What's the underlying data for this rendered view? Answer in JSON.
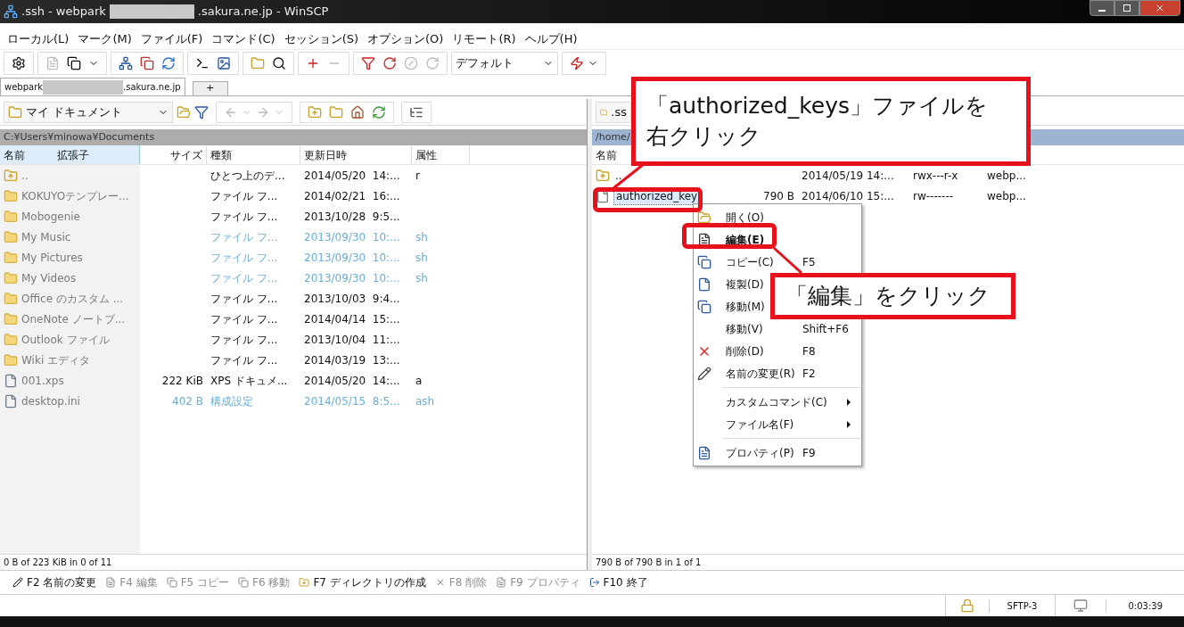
{
  "window": {
    "title_start": ".ssh - webpark",
    "title_end": ".sakura.ne.jp - WinSCP"
  },
  "menu": [
    "ローカル(L)",
    "マーク(M)",
    "ファイル(F)",
    "コマンド(C)",
    "セッション(S)",
    "オプション(O)",
    "リモート(R)",
    "ヘルプ(H)"
  ],
  "toolbar": {
    "transfer_preset": "デフォルト"
  },
  "tabs": [
    {
      "label_start": "webpark",
      "label_end": ".sakura.ne.jp",
      "selected": true
    }
  ],
  "new_tab": "+",
  "local": {
    "location": "マイ ドキュメント",
    "path": "C:¥Users¥minowa¥Documents",
    "columns": [
      "名前",
      "拡張子",
      "サイズ",
      "種類",
      "更新日時",
      "属性"
    ],
    "rows": [
      {
        "kind": "parent",
        "name": "..",
        "type": "ひとつ上のデ...",
        "date": "2014/05/20  14:...",
        "attr": "r",
        "hidden": false
      },
      {
        "kind": "folder",
        "name": "KOKUYOテンプレー...",
        "type": "ファイル フ...",
        "date": "2014/02/21  16:...",
        "hidden": false
      },
      {
        "kind": "folder",
        "name": "Mobogenie",
        "type": "ファイル フ...",
        "date": "2013/10/28  9:5...",
        "hidden": false
      },
      {
        "kind": "folder",
        "name": "My Music",
        "type": "ファイル フ...",
        "date": "2013/09/30  10:...",
        "attr": "sh",
        "hidden": true
      },
      {
        "kind": "folder",
        "name": "My Pictures",
        "type": "ファイル フ...",
        "date": "2013/09/30  10:...",
        "attr": "sh",
        "hidden": true
      },
      {
        "kind": "folder",
        "name": "My Videos",
        "type": "ファイル フ...",
        "date": "2013/09/30  10:...",
        "attr": "sh",
        "hidden": true
      },
      {
        "kind": "folder",
        "name": "Office のカスタム ...",
        "type": "ファイル フ...",
        "date": "2013/10/03  9:4...",
        "hidden": false
      },
      {
        "kind": "folder",
        "name": "OneNote ノートブ...",
        "type": "ファイル フ...",
        "date": "2014/04/14  15:...",
        "hidden": false
      },
      {
        "kind": "folder",
        "name": "Outlook ファイル",
        "type": "ファイル フ...",
        "date": "2013/10/04  11:...",
        "hidden": false
      },
      {
        "kind": "folder",
        "name": "Wiki エディタ",
        "type": "ファイル フ...",
        "date": "2014/03/19  13:...",
        "hidden": false
      },
      {
        "kind": "file",
        "name": "001.xps",
        "size": "222 KiB",
        "type": "XPS ドキュメ...",
        "date": "2014/05/20  14:...",
        "attr": "a",
        "hidden": false
      },
      {
        "kind": "file",
        "name": "desktop.ini",
        "size": "402 B",
        "type": "構成設定",
        "date": "2014/05/15  8:5...",
        "attr": "ash",
        "hidden": true
      }
    ],
    "status": "0 B of 223 KiB in 0 of 11"
  },
  "remote": {
    "location": ".ss",
    "path": "/home/",
    "columns": [
      "名前"
    ],
    "rows": [
      {
        "kind": "parent",
        "name": "..",
        "date": "2014/05/19 14:...",
        "rights": "rwx---r-x",
        "owner": "webp...",
        "selected": false
      },
      {
        "kind": "file",
        "name": "authorized_key",
        "size": "790 B",
        "date": "2014/06/10 15:...",
        "rights": "rw-------",
        "owner": "webp...",
        "selected": true
      }
    ],
    "status": "790 B of 790 B in 1 of 1"
  },
  "context_menu": [
    {
      "kind": "item",
      "label": "開く(O)",
      "bold": false
    },
    {
      "kind": "item",
      "label": "編集(E)",
      "bold": true
    },
    {
      "kind": "item",
      "label": "コピー(C)",
      "shortcut": "F5",
      "bold": false
    },
    {
      "kind": "item",
      "label": "複製(D)",
      "bold": false
    },
    {
      "kind": "item",
      "label": "移動(M)",
      "bold": false
    },
    {
      "kind": "item",
      "label": "移動(V)",
      "shortcut": "Shift+F6",
      "bold": false
    },
    {
      "kind": "item",
      "label": "削除(D)",
      "shortcut": "F8",
      "bold": false
    },
    {
      "kind": "item",
      "label": "名前の変更(R)",
      "shortcut": "F2",
      "bold": false
    },
    {
      "kind": "separator"
    },
    {
      "kind": "submenu",
      "label": "カスタムコマンド(C)",
      "bold": false
    },
    {
      "kind": "submenu",
      "label": "ファイル名(F)",
      "bold": false
    },
    {
      "kind": "separator"
    },
    {
      "kind": "item",
      "label": "プロパティ(P)",
      "shortcut": "F9",
      "bold": false
    }
  ],
  "function_keys": [
    {
      "label": "F2 名前の変更",
      "disabled": false
    },
    {
      "label": "F4 編集",
      "disabled": true
    },
    {
      "label": "F5 コピー",
      "disabled": true
    },
    {
      "label": "F6 移動",
      "disabled": true
    },
    {
      "label": "F7 ディレクトリの作成",
      "disabled": false
    },
    {
      "label": "F8 削除",
      "disabled": true
    },
    {
      "label": "F9 プロパティ",
      "disabled": true
    },
    {
      "label": "F10 終了",
      "disabled": false
    }
  ],
  "status_bar": {
    "protocol": "SFTP-3",
    "elapsed": "0:03:39"
  },
  "callouts": [
    {
      "lines": [
        "「authorized_keys」ファイルを",
        "右クリック"
      ]
    },
    {
      "lines": [
        "「編集」をクリック"
      ]
    }
  ]
}
